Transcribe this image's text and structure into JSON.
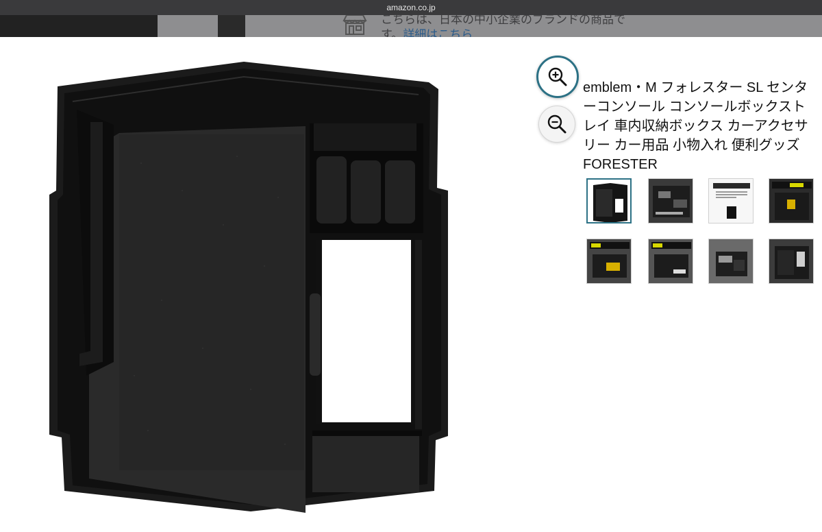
{
  "browser": {
    "url": "amazon.co.jp"
  },
  "background_notice": {
    "line1": "こちらは、日本の中小企業のブランドの商品で",
    "line2_prefix": "す。",
    "line2_link": "詳細はこちら"
  },
  "viewer": {
    "zoom_in_icon": "zoom-in-icon",
    "zoom_out_icon": "zoom-out-icon",
    "product_title": "emblem・M フォレスター SL センターコンソール コンソールボックストレイ 車内収納ボックス カーアクセサリー カー用品 小物入れ 便利グッズ FORESTER",
    "thumbnails": [
      {
        "name": "thumb-1",
        "selected": true
      },
      {
        "name": "thumb-2",
        "selected": false
      },
      {
        "name": "thumb-3",
        "selected": false
      },
      {
        "name": "thumb-4",
        "selected": false
      },
      {
        "name": "thumb-5",
        "selected": false
      },
      {
        "name": "thumb-6",
        "selected": false
      },
      {
        "name": "thumb-7",
        "selected": false
      },
      {
        "name": "thumb-8",
        "selected": false
      }
    ]
  },
  "colors": {
    "accent": "#2c7185",
    "tray": "#1a1a1a"
  }
}
